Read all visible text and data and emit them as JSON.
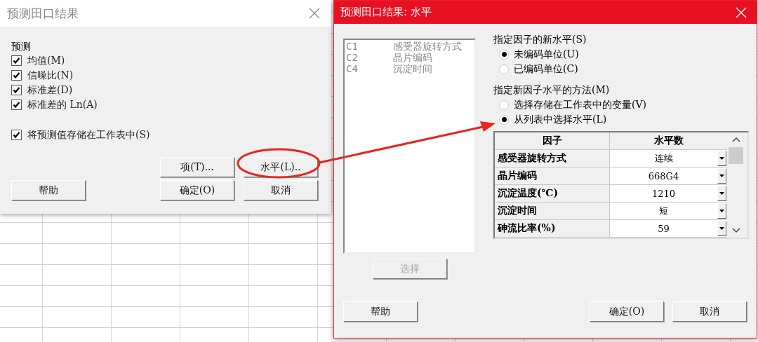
{
  "left_dialog": {
    "title": "预测田口结果",
    "group_label": "预测",
    "options": [
      {
        "label": "均值(M)",
        "checked": true
      },
      {
        "label": "信噪比(N)",
        "checked": true
      },
      {
        "label": "标准差(D)",
        "checked": true
      },
      {
        "label": "标准差的 Ln(A)",
        "checked": true
      }
    ],
    "store_option": {
      "label": "将预测值存储在工作表中(S)",
      "checked": true
    },
    "action_buttons": [
      "项(T)...",
      "水平(L).."
    ],
    "help_button": "帮助",
    "ok_button": "确定(O)",
    "cancel_button": "取消"
  },
  "right_dialog": {
    "title": "预测田口结果: 水平",
    "column_list": {
      "disabled": true,
      "items": [
        {
          "code": "C1",
          "name": "感受器旋转方式"
        },
        {
          "code": "C2",
          "name": "晶片编码"
        },
        {
          "code": "C4",
          "name": "沉淀时间"
        }
      ]
    },
    "select_button": {
      "label": "选择",
      "disabled": true
    },
    "level_group": {
      "label": "指定因子的新水平(S)",
      "options": [
        {
          "label": "未编码单位(U)",
          "selected": true
        },
        {
          "label": "已编码单位(C)",
          "selected": false
        }
      ]
    },
    "method_group": {
      "label": "指定新因子水平的方法(M)",
      "options": [
        {
          "label": "选择存储在工作表中的变量(V)",
          "selected": false
        },
        {
          "label": "从列表中选择水平(L)",
          "selected": true
        }
      ]
    },
    "table": {
      "columns": [
        "因子",
        "水平数"
      ],
      "rows": [
        {
          "factor": "感受器旋转方式",
          "level": "连续"
        },
        {
          "factor": "晶片编码",
          "level": "668G4"
        },
        {
          "factor": "沉淀温度(℃)",
          "level": "1210"
        },
        {
          "factor": "沉淀时间",
          "level": "短"
        },
        {
          "factor": "砷流比率(%)",
          "level": "59"
        }
      ]
    },
    "help_button": "帮助",
    "ok_button": "确定(O)",
    "cancel_button": "取消"
  }
}
